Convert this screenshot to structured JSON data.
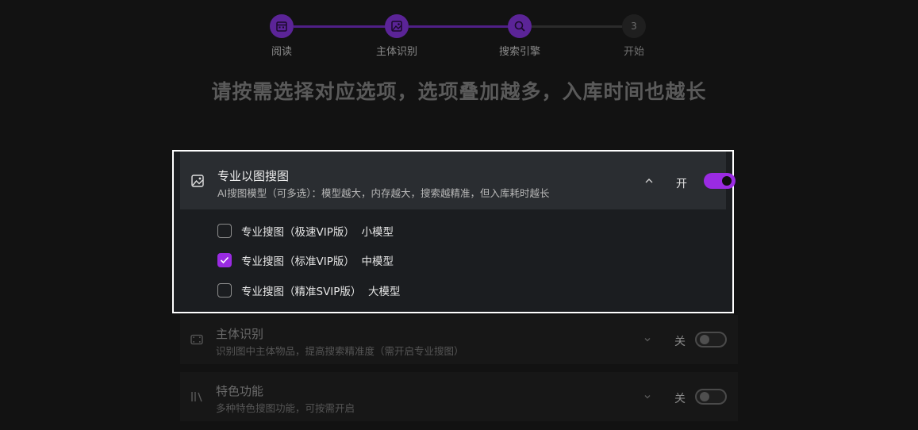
{
  "steps": [
    {
      "label": "阅读",
      "icon": "calendar-icon",
      "state": "done"
    },
    {
      "label": "主体识别",
      "icon": "image-icon",
      "state": "done"
    },
    {
      "label": "搜索引擎",
      "icon": "search-icon",
      "state": "done"
    },
    {
      "label": "开始",
      "number": "3",
      "state": "pending"
    }
  ],
  "headline": "请按需选择对应选项，选项叠加越多，入库时间也越长",
  "panel": {
    "title": "专业以图搜图",
    "subtitle": "AI搜图模型（可多选）：模型越大，内存越大，搜索越精准，但入库耗时越长",
    "toggle_label": "开",
    "toggle_on": true,
    "options": [
      {
        "label": "专业搜图（极速VIP版）  小模型",
        "checked": false
      },
      {
        "label": "专业搜图（标准VIP版）  中模型",
        "checked": true
      },
      {
        "label": "专业搜图（精准SVIP版）  大模型",
        "checked": false
      }
    ]
  },
  "sections": [
    {
      "title": "主体识别",
      "subtitle": "识别图中主体物品，提高搜索精准度（需开启专业搜图）",
      "toggle_label": "关",
      "toggle_on": false
    },
    {
      "title": "特色功能",
      "subtitle": "多种特色搜图功能，可按需开启",
      "toggle_label": "关",
      "toggle_on": false
    }
  ],
  "colors": {
    "accent": "#9a2be2",
    "step_done": "#5b2497",
    "background": "#121212"
  }
}
